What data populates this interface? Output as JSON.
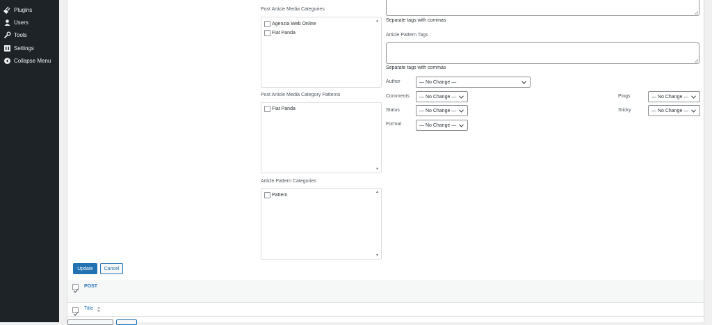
{
  "sidebar": {
    "items": [
      {
        "label": "Plugins",
        "icon": "plug-icon"
      },
      {
        "label": "Users",
        "icon": "user-icon"
      },
      {
        "label": "Tools",
        "icon": "wrench-icon"
      },
      {
        "label": "Settings",
        "icon": "settings-icon"
      },
      {
        "label": "Collapse Menu",
        "icon": "collapse-icon"
      }
    ]
  },
  "left_column": {
    "media_categories": {
      "label": "Post Article Media Categories",
      "items": [
        "Agenzia Web Online",
        "Fiat Panda"
      ]
    },
    "media_category_patterns": {
      "label": "Post Article Media Category Patterns",
      "items": [
        "Fiat Panda"
      ]
    },
    "pattern_categories": {
      "label": "Article Pattern Categories",
      "items": [
        "Pattern"
      ]
    }
  },
  "right_column": {
    "tags_help_1": "Separate tags with commas",
    "pattern_tags_label": "Article Pattern Tags",
    "tags_help_2": "Separate tags with commas",
    "author": {
      "label": "Author",
      "value": "— No Change —"
    },
    "comments": {
      "label": "Comments",
      "value": "— No Change —"
    },
    "status": {
      "label": "Status",
      "value": "— No Change —"
    },
    "format": {
      "label": "Format",
      "value": "— No Change —"
    },
    "pings": {
      "label": "Pings",
      "value": "— No Change —"
    },
    "sticky": {
      "label": "Sticky",
      "value": "— No Change —"
    }
  },
  "actions": {
    "update_label": "Update",
    "cancel_label": "Cancel"
  },
  "rows": {
    "post_label": "POST",
    "title_label": "Title"
  },
  "colors": {
    "sidebar_bg": "#1d2327",
    "accent": "#2271b1",
    "page_bg": "#f0f0f1"
  }
}
